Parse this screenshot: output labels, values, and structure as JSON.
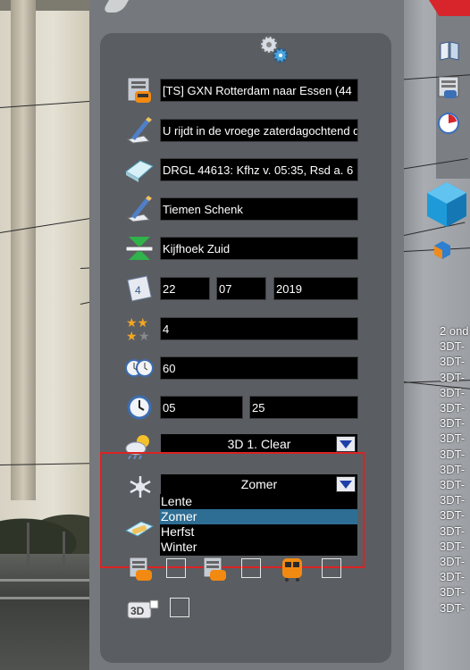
{
  "scenario": {
    "name": "[TS] GXN Rotterdam naar Essen (44",
    "description": "U rijdt in de vroege zaterdagochtend d",
    "briefing": "DRGL 44613: Kfhz v. 05:35, Rsd a. 6",
    "author": "Tiemen Schenk",
    "start_location": "Kijfhoek Zuid",
    "date": {
      "day": "22",
      "month": "07",
      "year": "2019"
    },
    "rating": "4",
    "duration": "60",
    "start_time": {
      "hours": "05",
      "minutes": "25"
    }
  },
  "weather": {
    "selected": "3D 1. Clear"
  },
  "season": {
    "selected": "Zomer",
    "options": [
      "Lente",
      "Zomer",
      "Herfst",
      "Winter"
    ],
    "highlighted_option": "Zomer"
  },
  "checkboxes": [
    {
      "icon": "consist-train-icon",
      "checked": false
    },
    {
      "icon": "consist-train-icon",
      "checked": false
    },
    {
      "icon": "orange-train-icon",
      "checked": false
    },
    {
      "icon": "3d-icon",
      "checked": false
    }
  ],
  "side_list": {
    "header": "2 ond",
    "items": [
      "3DT-",
      "3DT-",
      "3DT-",
      "3DT-",
      "3DT-",
      "3DT-",
      "3DT-",
      "3DT-",
      "3DT-",
      "3DT-",
      "3DT-",
      "3DT-",
      "3DT-",
      "3DT-",
      "3DT-",
      "3DT-",
      "3DT-",
      "3DT-"
    ]
  },
  "colors": {
    "panel": "#75787d",
    "panel_inner": "#5a5d62",
    "selection": "#2f6e94",
    "highlight_box": "#dd2222",
    "dropdown_arrow": "#1f3fa8"
  }
}
